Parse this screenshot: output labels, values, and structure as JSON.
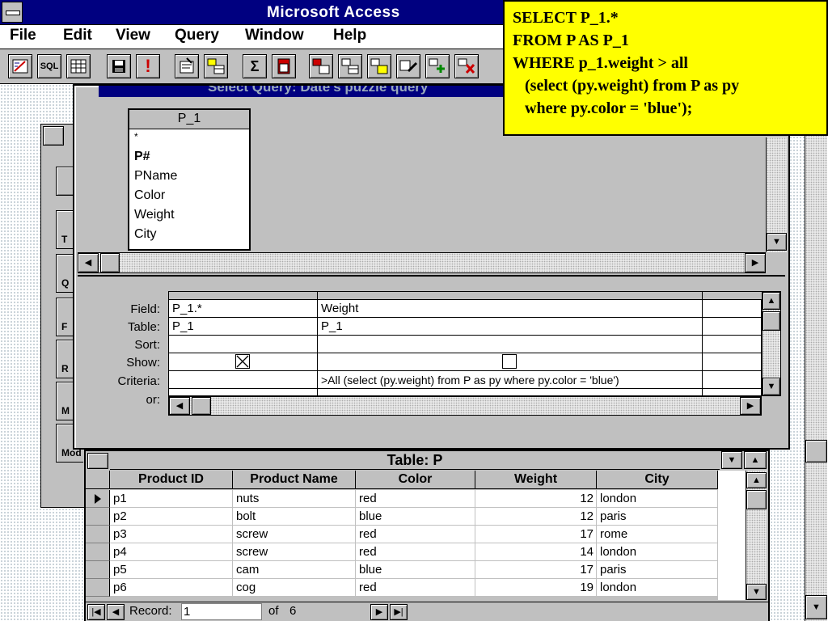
{
  "app": {
    "title": "Microsoft Access"
  },
  "menu": [
    "File",
    "Edit",
    "View",
    "Query",
    "Window",
    "Help"
  ],
  "toolbar": {
    "buttons": [
      {
        "icon": "design-view-icon"
      },
      {
        "icon": "sql-view-icon",
        "label": "SQL"
      },
      {
        "icon": "datasheet-view-icon"
      },
      {
        "icon": "save-icon"
      },
      {
        "icon": "run-icon",
        "label": "!"
      },
      {
        "icon": "properties-icon"
      },
      {
        "icon": "add-table-icon"
      },
      {
        "icon": "totals-icon",
        "label": "Σ"
      },
      {
        "icon": "crosstab-icon"
      },
      {
        "icon": "make-table-icon"
      },
      {
        "icon": "update-query-icon"
      },
      {
        "icon": "append-query-icon"
      },
      {
        "icon": "edit-query-icon"
      },
      {
        "icon": "add-icon"
      },
      {
        "icon": "delete-query-icon"
      }
    ]
  },
  "db_window": {
    "tabs": [
      "T",
      "Q",
      "F",
      "R",
      "M",
      "Mod"
    ]
  },
  "query_window": {
    "title": "Select Query: Date's puzzle query",
    "table": {
      "name": "P_1",
      "fields": [
        "*",
        "P#",
        "PName",
        "Color",
        "Weight",
        "City"
      ]
    },
    "row_labels": [
      "Field:",
      "Table:",
      "Sort:",
      "Show:",
      "Criteria:",
      "or:"
    ],
    "columns": [
      {
        "field": "P_1.*",
        "table": "P_1",
        "sort": "",
        "show": true,
        "criteria": "",
        "or": ""
      },
      {
        "field": "Weight",
        "table": "P_1",
        "sort": "",
        "show": false,
        "criteria": ">All (select (py.weight) from P as py where py.color = 'blue')",
        "or": ""
      }
    ]
  },
  "table_window": {
    "title": "Table: P",
    "headers": [
      "Product ID",
      "Product Name",
      "Color",
      "Weight",
      "City"
    ],
    "rows": [
      [
        "p1",
        "nuts",
        "red",
        "12",
        "london"
      ],
      [
        "p2",
        "bolt",
        "blue",
        "12",
        "paris"
      ],
      [
        "p3",
        "screw",
        "red",
        "17",
        "rome"
      ],
      [
        "p4",
        "screw",
        "red",
        "14",
        "london"
      ],
      [
        "p5",
        "cam",
        "blue",
        "17",
        "paris"
      ],
      [
        "p6",
        "cog",
        "red",
        "19",
        "london"
      ]
    ],
    "nav": {
      "label": "Record:",
      "current": "1",
      "of_label": "of",
      "total": "6"
    }
  },
  "sql_note": {
    "lines": [
      "SELECT P_1.*",
      "FROM P AS P_1",
      "WHERE p_1.weight > all",
      "   (select (py.weight) from P as py",
      "   where py.color = 'blue');"
    ]
  }
}
